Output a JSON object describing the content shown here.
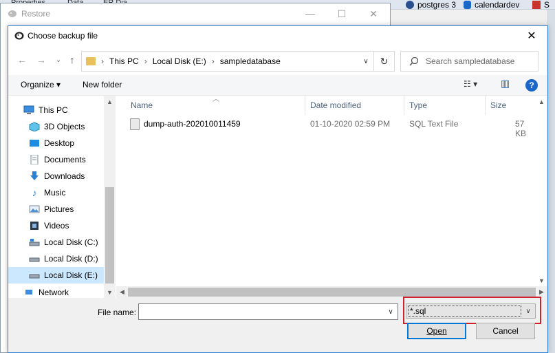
{
  "background_app": {
    "tabs": [
      "Properties",
      "Data",
      "ER Dia"
    ],
    "connections": [
      {
        "label": "postgres 3",
        "icon": "postgres-icon"
      },
      {
        "label": "calendardev",
        "icon": "database-icon"
      },
      {
        "label": "S",
        "icon": "server-icon"
      }
    ]
  },
  "restore_window": {
    "title": "Restore",
    "controls": {
      "minimize": "—",
      "maximize": "☐",
      "close": "✕"
    }
  },
  "dialog": {
    "title": "Choose backup file",
    "close": "✕",
    "nav": {
      "back": "←",
      "forward": "→",
      "up": "↑"
    },
    "address": {
      "segments": [
        "This PC",
        "Local Disk (E:)",
        "sampledatabase"
      ],
      "separator": "›",
      "refresh": "↻"
    },
    "search": {
      "placeholder": "Search sampledatabase",
      "icon": "search-icon"
    },
    "toolbar": {
      "organize": "Organize ▾",
      "new_folder": "New folder",
      "view_icon": "☷ ▾",
      "pane_icon": "▥",
      "help": "?"
    },
    "navpane": {
      "items": [
        {
          "label": "This PC",
          "icon": "computer-icon"
        },
        {
          "label": "3D Objects",
          "icon": "cube-icon"
        },
        {
          "label": "Desktop",
          "icon": "desktop-icon"
        },
        {
          "label": "Documents",
          "icon": "document-icon"
        },
        {
          "label": "Downloads",
          "icon": "download-icon"
        },
        {
          "label": "Music",
          "icon": "music-icon"
        },
        {
          "label": "Pictures",
          "icon": "picture-icon"
        },
        {
          "label": "Videos",
          "icon": "video-icon"
        },
        {
          "label": "Local Disk (C:)",
          "icon": "drive-icon"
        },
        {
          "label": "Local Disk (D:)",
          "icon": "drive-icon"
        },
        {
          "label": "Local Disk (E:)",
          "icon": "drive-icon",
          "selected": true
        },
        {
          "label": "Network",
          "icon": "network-icon"
        }
      ]
    },
    "columns": [
      "Name",
      "Date modified",
      "Type",
      "Size"
    ],
    "files": [
      {
        "name": "dump-auth-202010011459",
        "date_modified": "01-10-2020 02:59 PM",
        "type": "SQL Text File",
        "size": "57 KB"
      }
    ],
    "bottom": {
      "file_name_label": "File name:",
      "file_name_value": "",
      "filter_value": "*.sql",
      "open": "Open",
      "cancel": "Cancel"
    },
    "colors": {
      "highlight_box": "#d0222c",
      "selection": "#cce8ff",
      "accent": "#0078d7"
    }
  }
}
